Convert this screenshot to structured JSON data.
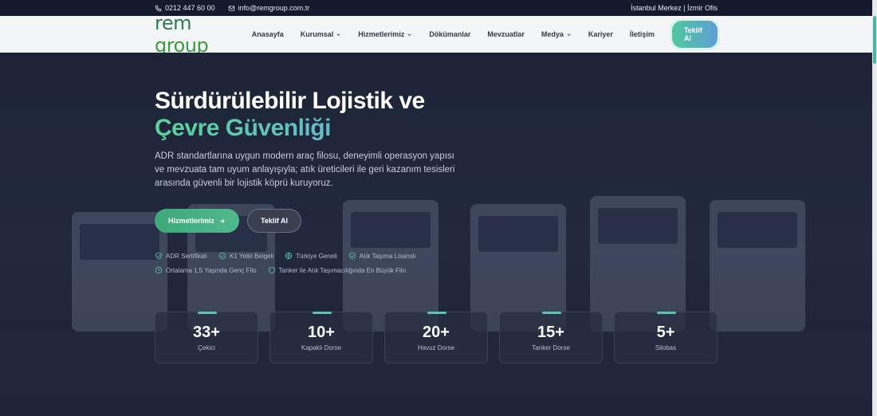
{
  "topbar": {
    "phone": "0212 447 60 00",
    "email": "info@remgroup.com.tr",
    "offices": "İstanbul Merkez | İzmir Ofis"
  },
  "logo": {
    "part1": "rem",
    "part2": "group"
  },
  "nav": {
    "items": [
      {
        "label": "Anasayfa",
        "dropdown": false
      },
      {
        "label": "Kurumsal",
        "dropdown": true
      },
      {
        "label": "Hizmetlerimiz",
        "dropdown": true
      },
      {
        "label": "Dökümanlar",
        "dropdown": false
      },
      {
        "label": "Mevzuatlar",
        "dropdown": false
      },
      {
        "label": "Medya",
        "dropdown": true
      },
      {
        "label": "Kariyer",
        "dropdown": false
      },
      {
        "label": "İletişim",
        "dropdown": false
      }
    ],
    "cta": "Teklif Al"
  },
  "hero": {
    "title_line1": "Sürdürülebilir Lojistik ve",
    "title_line2": "Çevre Güvenliği",
    "description": "ADR standartlarına uygun modern araç filosu, deneyimli operasyon yapısı ve mevzuata tam uyum anlayışıyla; atık üreticileri ile geri kazanım tesisleri arasında güvenli bir lojistik köprü kuruyoruz.",
    "primary_button": "Hizmetlerimiz",
    "secondary_button": "Teklif Al"
  },
  "badges": {
    "row1": [
      {
        "label": "ADR Sertifikalı",
        "icon": "shield-check-icon"
      },
      {
        "label": "K1 Yetki Belgeli",
        "icon": "circle-check-icon"
      },
      {
        "label": "Türkiye Geneli",
        "icon": "globe-icon"
      },
      {
        "label": "Atık Taşıma Lisanslı",
        "icon": "shield-check-icon"
      }
    ],
    "row2": [
      {
        "label": "Ortalama 1,5 Yaşında Genç Filo",
        "icon": "clock-icon"
      },
      {
        "label": "Tanker ile Atık Taşımacılığında En Büyük Filo",
        "icon": "shield-icon"
      }
    ]
  },
  "stats": [
    {
      "value": "33+",
      "label": "Çekici"
    },
    {
      "value": "10+",
      "label": "Kapaklı Dorse"
    },
    {
      "value": "20+",
      "label": "Havuz Dorse"
    },
    {
      "value": "15+",
      "label": "Tanker Dorse"
    },
    {
      "value": "5+",
      "label": "Silobas"
    }
  ],
  "colors": {
    "accent_green": "#4fb98e",
    "accent_blue": "#5f9fd4",
    "background": "#1b2035"
  }
}
